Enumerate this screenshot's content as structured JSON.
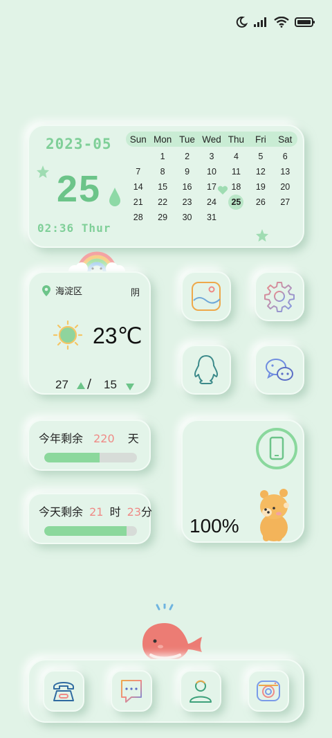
{
  "colors": {
    "background": "#e1f3e7",
    "accent_green": "#6cc489",
    "accent_red": "#ef8a86"
  },
  "status_bar": {
    "icons": [
      "moon-icon",
      "signal-icon",
      "wifi-icon",
      "battery-icon"
    ]
  },
  "calendar": {
    "year_month": "2023-05",
    "day": "25",
    "time": "02:36 Thur",
    "weekdays": [
      "Sun",
      "Mon",
      "Tue",
      "Wed",
      "Thu",
      "Fri",
      "Sat"
    ],
    "rows": [
      [
        "",
        "1",
        "2",
        "3",
        "4",
        "5",
        "6"
      ],
      [
        "7",
        "8",
        "9",
        "10",
        "11",
        "12",
        "13"
      ],
      [
        "14",
        "15",
        "16",
        "17",
        "18",
        "19",
        "20"
      ],
      [
        "21",
        "22",
        "23",
        "24",
        "25",
        "26",
        "27"
      ],
      [
        "28",
        "29",
        "30",
        "31",
        "",
        "",
        ""
      ]
    ],
    "today": "25"
  },
  "weather": {
    "location": "海淀区",
    "condition": "阴",
    "temperature": "23℃",
    "high": "27",
    "separator": "/",
    "low": "15"
  },
  "apps": [
    {
      "name": "gallery-app",
      "icon": "gallery-icon"
    },
    {
      "name": "settings-app",
      "icon": "gear-icon"
    },
    {
      "name": "qq-app",
      "icon": "penguin-icon"
    },
    {
      "name": "wechat-app",
      "icon": "chat-bubbles-icon"
    }
  ],
  "year_remaining": {
    "prefix": "今年剩余",
    "days": "220",
    "unit": "天",
    "progress": 0.6
  },
  "day_remaining": {
    "prefix": "今天剩余",
    "hours": "21",
    "hour_unit": "时",
    "minutes": "23",
    "minute_unit": "分",
    "progress": 0.89
  },
  "battery_widget": {
    "percent": "100%",
    "icon": "phone-icon"
  },
  "dock": [
    {
      "name": "phone-app",
      "icon": "telephone-icon"
    },
    {
      "name": "messages-app",
      "icon": "message-icon"
    },
    {
      "name": "contacts-app",
      "icon": "contact-icon"
    },
    {
      "name": "camera-app",
      "icon": "camera-icon"
    }
  ]
}
